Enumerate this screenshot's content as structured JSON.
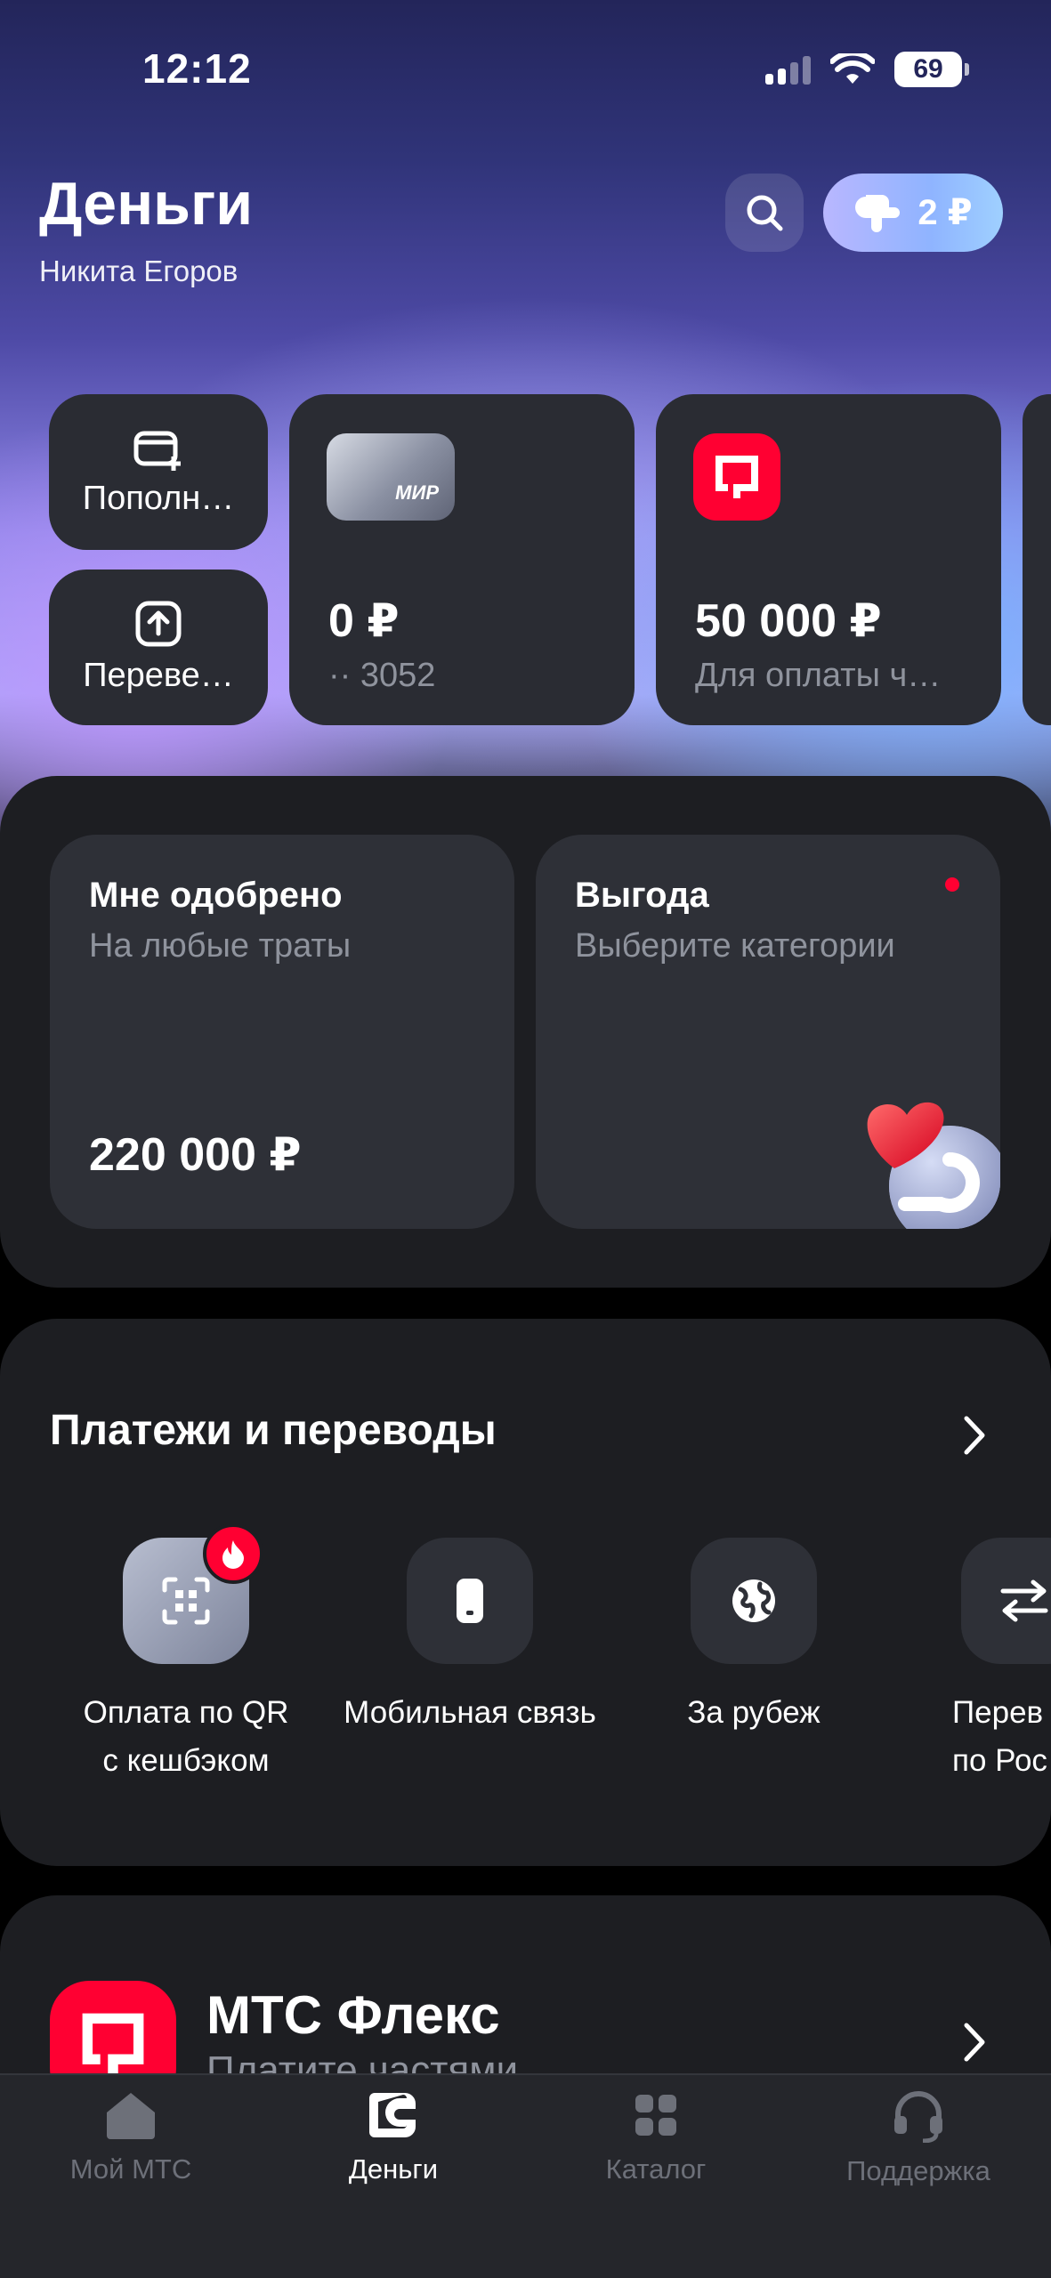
{
  "status_bar": {
    "time": "12:12",
    "battery": "69"
  },
  "header": {
    "title": "Деньги",
    "user_name": "Никита Егоров",
    "cashback": "2 ₽"
  },
  "quick_tiles": {
    "top_up": "Пополн…",
    "transfer": "Переве…"
  },
  "cards": [
    {
      "amount": "0 ₽",
      "sub": "·· 3052",
      "brand": "МИР"
    },
    {
      "amount": "50 000 ₽",
      "sub": "Для оплаты ч…"
    }
  ],
  "offers": {
    "approved": {
      "title": "Мне одобрено",
      "subtitle": "На любые траты",
      "amount": "220 000 ₽"
    },
    "benefit": {
      "title": "Выгода",
      "subtitle": "Выберите категории"
    }
  },
  "payments": {
    "title": "Платежи и переводы",
    "actions": [
      {
        "label_1": "Оплата по QR",
        "label_2": "с кешбэком",
        "icon": "qr-scan-icon"
      },
      {
        "label_1": "Мобильная связь",
        "label_2": "",
        "icon": "phone-icon"
      },
      {
        "label_1": "За рубеж",
        "label_2": "",
        "icon": "globe-icon"
      },
      {
        "label_1": "Перев",
        "label_2": "по Рос",
        "icon": "transfer-arrows-icon"
      }
    ]
  },
  "flex": {
    "title": "МТС Флекс",
    "subtitle": "Платите частями"
  },
  "bottom_nav": [
    {
      "label": "Мой МТС",
      "icon": "home-icon",
      "active": false
    },
    {
      "label": "Деньги",
      "icon": "money-icon",
      "active": true
    },
    {
      "label": "Каталог",
      "icon": "catalog-icon",
      "active": false
    },
    {
      "label": "Поддержка",
      "icon": "support-icon",
      "active": false
    }
  ],
  "colors": {
    "accent_red": "#ff0032",
    "card_bg": "#2a2c33",
    "section_bg": "#1d1e22"
  }
}
